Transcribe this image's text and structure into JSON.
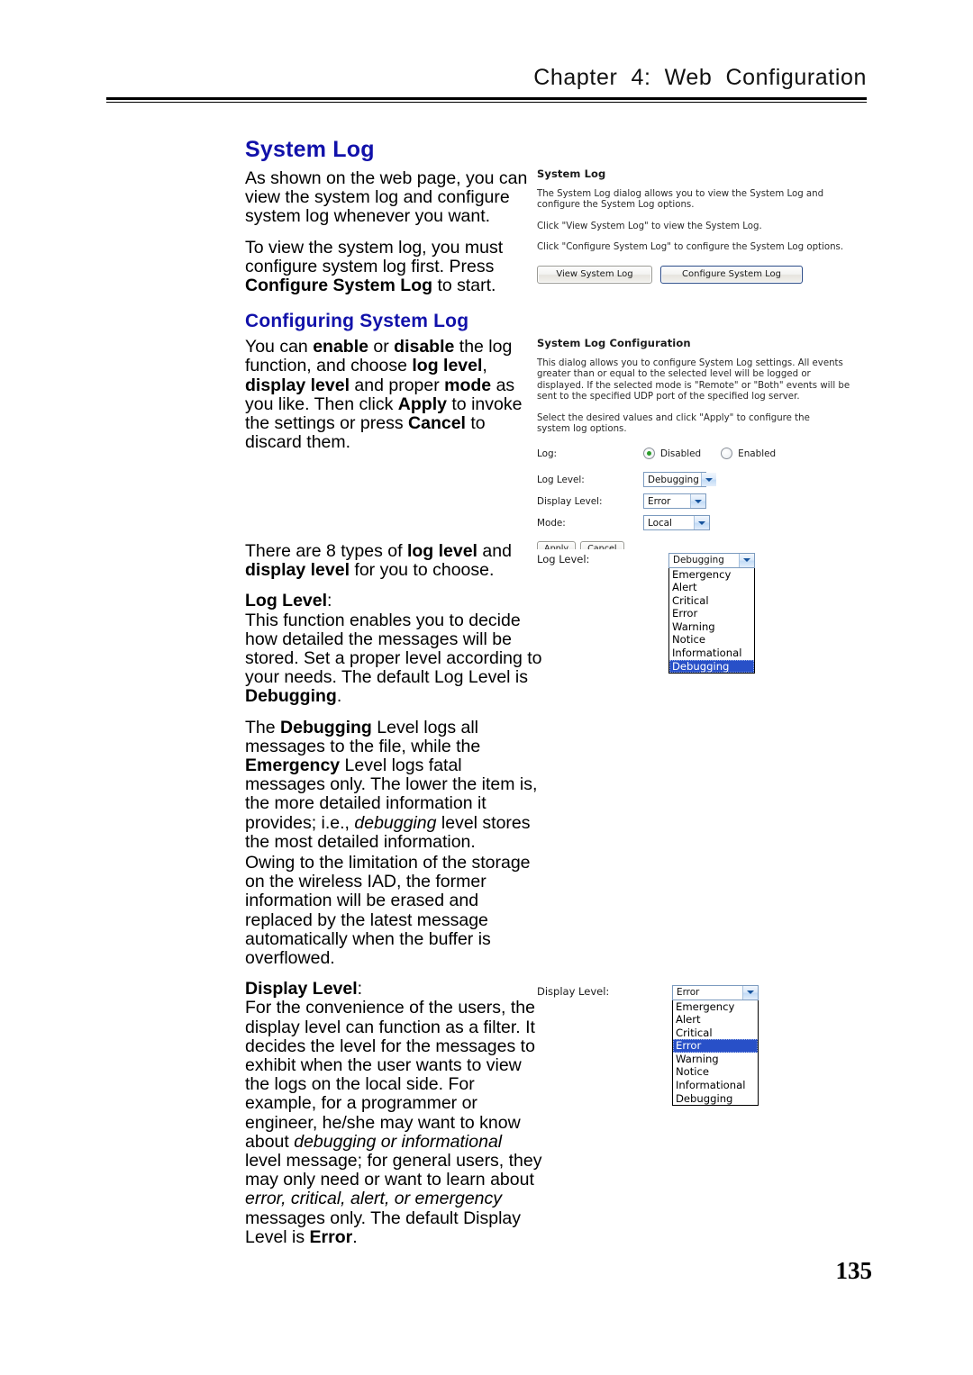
{
  "header": {
    "running_head": "Chapter  4:  Web  Configuration",
    "page_number": "135"
  },
  "document": {
    "section_title": "System Log",
    "subsection_title": "Configuring System Log",
    "paragraphs": {
      "p1": "As shown on the web page, you can view the system log and configure system log whenever you want.",
      "p2_a": "To view the system log, you must configure system log first. Press ",
      "p2_b": "Configure System Log",
      "p2_c": " to start.",
      "p3_a": "You can ",
      "p3_b": "enable",
      "p3_c": " or ",
      "p3_d": "disable",
      "p3_e": " the log function, and choose ",
      "p3_f": "log level",
      "p3_g": ", ",
      "p3_h": "display level",
      "p3_i": " and proper ",
      "p3_j": "mode",
      "p3_k": " as you like. Then click ",
      "p3_l": "Apply",
      "p3_m": " to invoke the settings or press ",
      "p3_n": "Cancel",
      "p3_o": " to discard them.",
      "p4_a": "There are 8 types of ",
      "p4_b": "log level",
      "p4_c": " and ",
      "p4_d": "display level",
      "p4_e": " for you to choose.",
      "p5_heading": "Log Level",
      "p5_colon": ":",
      "p5_body_a": "This function enables you to decide how detailed the messages will be stored. Set a proper level according to your needs. The default Log Level is ",
      "p5_body_b": "Debugging",
      "p5_body_c": ".",
      "p6_a": "The ",
      "p6_b": "Debugging",
      "p6_c": " Level logs all messages to the file, while the ",
      "p6_d": "Emergency",
      "p6_e": " Level logs fatal messages only. The lower the item is, the more detailed information it provides; i.e., ",
      "p6_f": "debugging",
      "p6_g": " level stores the most detailed information.",
      "p7": "Owing to the limitation of the storage on the wireless IAD, the former information will be erased and replaced by the latest message automatically when the buffer is overflowed.",
      "p8_heading": "Display Level",
      "p8_colon": ":",
      "p8_a": "For the convenience of the users, the display level can function as a filter. It decides the level for the messages to exhibit when the user wants to view the logs on the local side. For example,      for a programmer or engineer, he/she may want to know about ",
      "p8_b": "debugging or informational",
      "p8_c": " level message; for general users, they may only need or want to learn about ",
      "p8_d": "error, critical, alert, or emergency",
      "p8_e": " messages only. The default Display Level is ",
      "p8_f": "Error",
      "p8_g": "."
    }
  },
  "screenshot_system_log": {
    "title": "System Log",
    "desc_1": "The System Log dialog allows you to view the System Log and configure the System Log options.",
    "desc_2": "Click \"View System Log\" to view the System Log.",
    "desc_3": "Click \"Configure System Log\" to configure the System Log options.",
    "button_view": "View System Log",
    "button_configure": "Configure System Log"
  },
  "screenshot_system_log_config": {
    "title": "System Log Configuration",
    "desc_1": "This dialog allows you to configure System Log settings. All events greater than or equal to the selected level will be logged or displayed. If the selected mode is \"Remote\" or \"Both\" events will be sent to the specified UDP port of the specified log server.",
    "desc_2": "Select the desired values and click \"Apply\" to configure the system log options.",
    "log_label": "Log:",
    "radio_disabled": "Disabled",
    "radio_enabled": "Enabled",
    "radio_selected": "Disabled",
    "log_level_label": "Log Level:",
    "log_level_value": "Debugging",
    "display_level_label": "Display Level:",
    "display_level_value": "Error",
    "mode_label": "Mode:",
    "mode_value": "Local",
    "button_apply": "Apply",
    "button_cancel": "Cancel"
  },
  "figure_log_level_dropdown": {
    "label": "Log Level:",
    "selected": "Debugging",
    "options": [
      "Emergency",
      "Alert",
      "Critical",
      "Error",
      "Warning",
      "Notice",
      "Informational",
      "Debugging"
    ]
  },
  "figure_display_level_dropdown": {
    "label": "Display Level:",
    "selected": "Error",
    "options": [
      "Emergency",
      "Alert",
      "Critical",
      "Error",
      "Warning",
      "Notice",
      "Informational",
      "Debugging"
    ]
  },
  "colors": {
    "heading_blue": "#1111aa",
    "selection_blue": "#2850c8",
    "radio_green": "#2a9c2a",
    "combo_border": "#7c9bbf"
  }
}
